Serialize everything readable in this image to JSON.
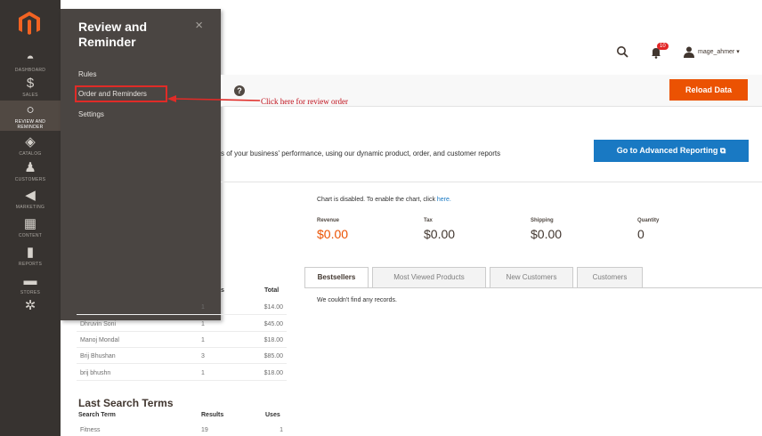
{
  "sidebar": {
    "items": [
      {
        "id": "dashboard",
        "label": "DASHBOARD",
        "icon": "dashboard-icon",
        "glyph": "◓"
      },
      {
        "id": "sales",
        "label": "SALES",
        "icon": "dollar-icon",
        "glyph": "$"
      },
      {
        "id": "review",
        "label": "REVIEW AND REMINDER",
        "icon": "circle-icon",
        "glyph": "○"
      },
      {
        "id": "catalog",
        "label": "CATALOG",
        "icon": "cube-icon",
        "glyph": "◈"
      },
      {
        "id": "customers",
        "label": "CUSTOMERS",
        "icon": "person-icon",
        "glyph": "♟"
      },
      {
        "id": "marketing",
        "label": "MARKETING",
        "icon": "megaphone-icon",
        "glyph": "◀"
      },
      {
        "id": "content",
        "label": "CONTENT",
        "icon": "layout-icon",
        "glyph": "▦"
      },
      {
        "id": "reports",
        "label": "REPORTS",
        "icon": "bar-chart-icon",
        "glyph": "▮"
      },
      {
        "id": "stores",
        "label": "STORES",
        "icon": "store-icon",
        "glyph": "▬"
      },
      {
        "id": "system",
        "label": "",
        "icon": "gear-icon",
        "glyph": "✲"
      }
    ]
  },
  "flyout": {
    "title": "Review and Reminder",
    "close": "×",
    "items": [
      "Rules",
      "Order and Reminders",
      "Settings"
    ]
  },
  "header": {
    "badge": "10",
    "username": "mage_ahmer ▾"
  },
  "toolbar": {
    "reload_label": "Reload Data",
    "help": "?"
  },
  "annotation": {
    "text": "Click here for review order",
    "color": "#c0101b"
  },
  "info": {
    "text": "s of your business' performance, using our dynamic product, order, and customer reports",
    "advanced_label": "Go to Advanced Reporting ⧉"
  },
  "dashboard": {
    "chart_disabled": "Chart is disabled. To enable the chart, click ",
    "chart_link": "here.",
    "totals": [
      {
        "label": "Revenue",
        "value": "$0.00"
      },
      {
        "label": "Tax",
        "value": "$0.00"
      },
      {
        "label": "Shipping",
        "value": "$0.00"
      },
      {
        "label": "Quantity",
        "value": "0"
      }
    ],
    "tabs": [
      "Bestsellers",
      "Most Viewed Products",
      "New Customers",
      "Customers"
    ],
    "no_records": "We couldn't find any records."
  },
  "customers_table": {
    "headers": [
      "s",
      "Total"
    ],
    "rows": [
      {
        "name": "",
        "orders": "1",
        "total": "$14.00"
      },
      {
        "name": "Dhruvin Soni",
        "orders": "1",
        "total": "$45.00"
      },
      {
        "name": "Manoj Mondal",
        "orders": "1",
        "total": "$18.00"
      },
      {
        "name": "Brij Bhushan",
        "orders": "3",
        "total": "$85.00"
      },
      {
        "name": "brij bhushn",
        "orders": "1",
        "total": "$18.00"
      }
    ]
  },
  "search_terms": {
    "title": "Last Search Terms",
    "headers": [
      "Search Term",
      "Results",
      "Uses"
    ],
    "rows": [
      {
        "term": "Fitness",
        "results": "19",
        "uses": "1"
      }
    ]
  },
  "colors": {
    "sidebar": "#373330",
    "flyout": "#4a4542",
    "orange": "#eb5202",
    "blue": "#1979c3",
    "red": "#e02b27"
  }
}
